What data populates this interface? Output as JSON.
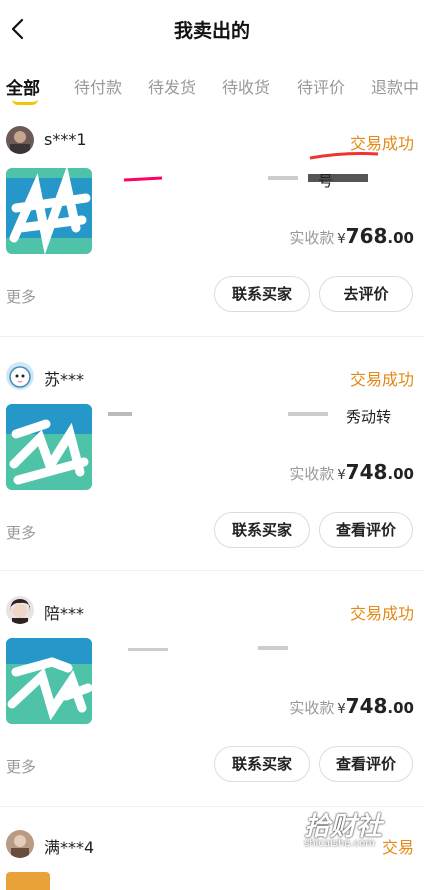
{
  "header": {
    "title": "我卖出的",
    "back_icon": "chevron-left-icon"
  },
  "tabs": [
    {
      "label": "全部",
      "active": true
    },
    {
      "label": "待付款",
      "active": false
    },
    {
      "label": "待发货",
      "active": false
    },
    {
      "label": "待收货",
      "active": false
    },
    {
      "label": "待评价",
      "active": false
    },
    {
      "label": "退款中",
      "active": false
    }
  ],
  "colors": {
    "status": "#e28a14",
    "tab_indicator": "#f5c400",
    "muted": "#999999"
  },
  "orders": [
    {
      "buyer": "s***1",
      "status": "交易成功",
      "title_visible": "号",
      "price_label": "实收款",
      "currency": "¥",
      "price_int": "768",
      "price_dec": ".00",
      "more": "更多",
      "action1": "联系买家",
      "action2": "去评价"
    },
    {
      "buyer": "苏***",
      "status": "交易成功",
      "title_visible": "秀动转",
      "price_label": "实收款",
      "currency": "¥",
      "price_int": "748",
      "price_dec": ".00",
      "more": "更多",
      "action1": "联系买家",
      "action2": "查看评价"
    },
    {
      "buyer": "陪***",
      "status": "交易成功",
      "title_visible": "",
      "price_label": "实收款",
      "currency": "¥",
      "price_int": "748",
      "price_dec": ".00",
      "more": "更多",
      "action1": "联系买家",
      "action2": "查看评价"
    },
    {
      "buyer": "满***4",
      "status": "交易",
      "title_visible": ""
    }
  ],
  "watermark": {
    "big": "拾财社",
    "small": "shicaishe.com"
  }
}
